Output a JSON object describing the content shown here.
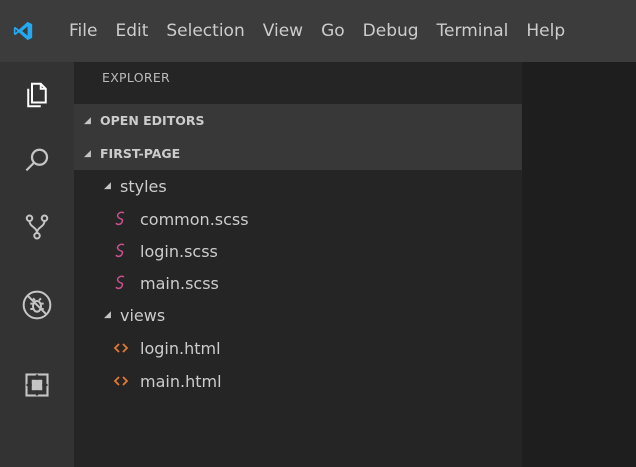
{
  "menubar": {
    "items": [
      "File",
      "Edit",
      "Selection",
      "View",
      "Go",
      "Debug",
      "Terminal",
      "Help"
    ]
  },
  "activitybar": {
    "icons": [
      "files-icon",
      "search-icon",
      "source-control-icon",
      "debug-icon",
      "extensions-icon"
    ]
  },
  "sidebar": {
    "title": "EXPLORER",
    "sections": {
      "open_editors": "OPEN EDITORS",
      "workspace": "FIRST-PAGE"
    },
    "tree": {
      "folder_styles": "styles",
      "styles_files": [
        "common.scss",
        "login.scss",
        "main.scss"
      ],
      "folder_views": "views",
      "views_files": [
        "login.html",
        "main.html"
      ]
    }
  },
  "colors": {
    "scss_icon": "#c6538c",
    "html_icon": "#e37933",
    "vscode_blue": "#23a9f2"
  }
}
